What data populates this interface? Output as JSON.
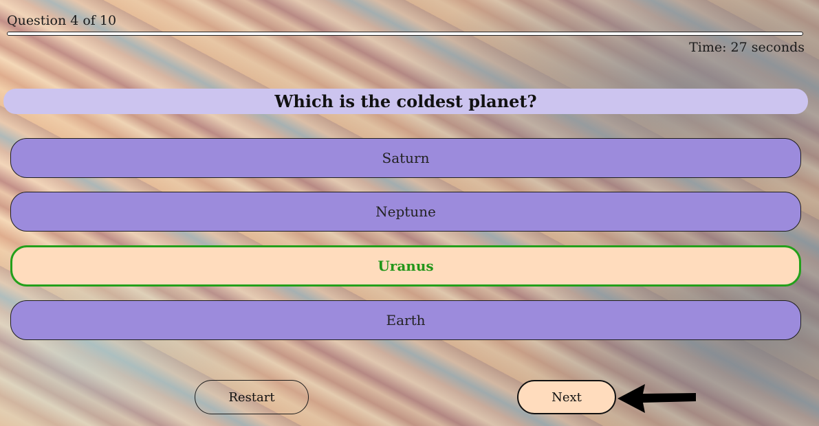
{
  "quiz": {
    "progress_label": "Question 4 of 10",
    "progress_fraction": 0.4,
    "timer_label": "Time:",
    "timer_value": "27 seconds",
    "question": "Which is the coldest planet?",
    "answers": [
      {
        "label": "Saturn",
        "selected": false
      },
      {
        "label": "Neptune",
        "selected": false
      },
      {
        "label": "Uranus",
        "selected": true
      },
      {
        "label": "Earth",
        "selected": false
      }
    ],
    "restart_label": "Restart",
    "next_label": "Next"
  },
  "colors": {
    "question_bg": "#ccc4ef",
    "answer_bg": "#9c8bdc",
    "selected_bg": "#ffdcbd",
    "selected_border": "#23a01b",
    "next_bg": "#ffdcbd"
  },
  "icons": {
    "pointer": "arrow-left-icon"
  }
}
